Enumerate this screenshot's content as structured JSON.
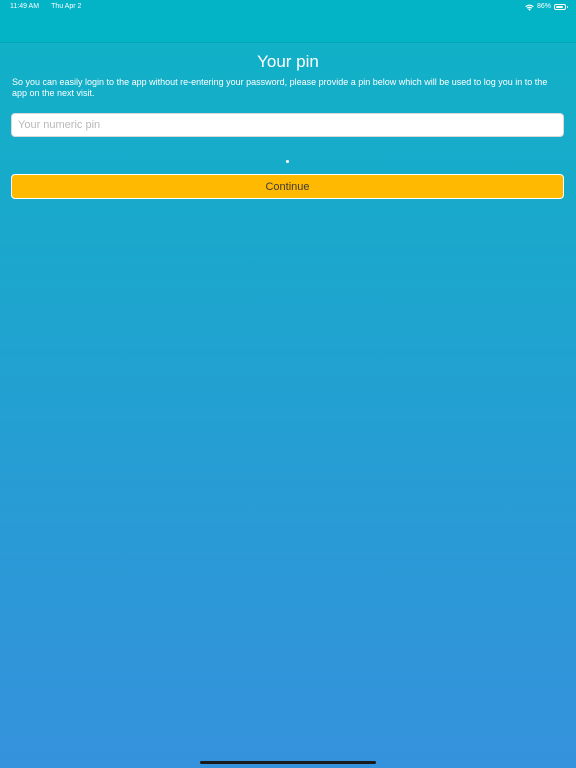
{
  "status_bar": {
    "time": "11:49 AM",
    "date": "Thu Apr 2",
    "battery_percent": "86%",
    "battery_level": 0.86
  },
  "icons": {
    "wifi": "wifi-icon",
    "battery": "battery-icon"
  },
  "page": {
    "title": "Your pin",
    "description": "So you can easily login to the app without re-entering your password, please provide a pin below which will be used to log you in to the app on the next visit."
  },
  "pin_input": {
    "placeholder": "Your numeric pin",
    "value": ""
  },
  "continue_button": {
    "label": "Continue"
  },
  "colors": {
    "nav_bar": "#03b4c6",
    "background_top": "#0fb3c6",
    "background_bottom": "#3592dc",
    "button": "#ffb900",
    "text_light": "#ffffff"
  }
}
